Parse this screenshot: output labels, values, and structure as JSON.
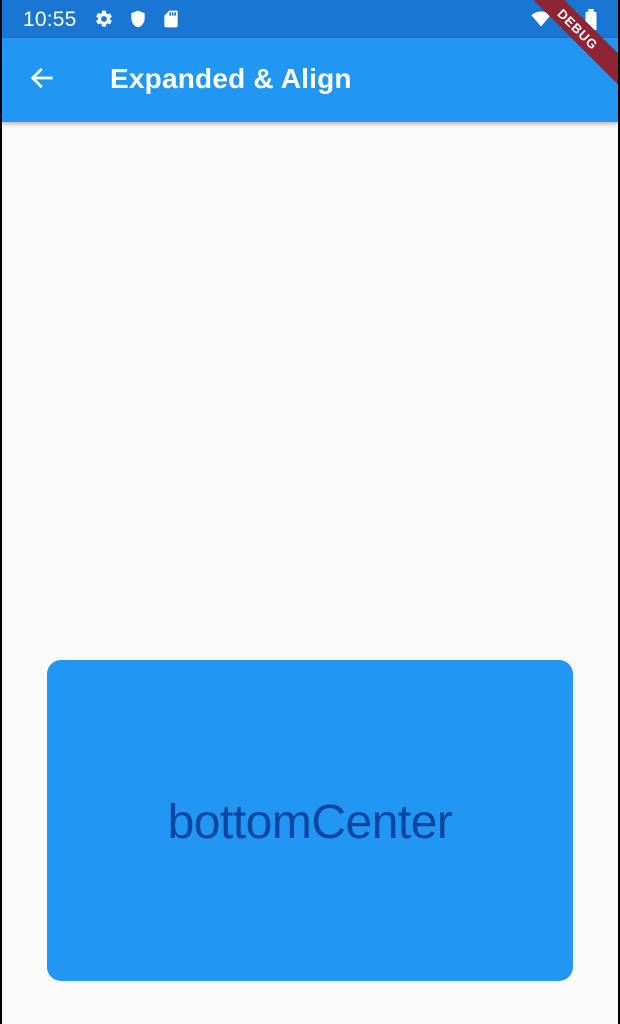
{
  "status_bar": {
    "time": "10:55",
    "icons": [
      "settings-icon",
      "shield-icon",
      "sd-card-icon",
      "wifi-icon",
      "signal-icon",
      "battery-icon"
    ],
    "color": "#1976d2"
  },
  "app_bar": {
    "title": "Expanded & Align",
    "back_icon": "arrow-back-icon",
    "color": "#2196f3"
  },
  "content": {
    "box_label": "bottomCenter",
    "box_color": "#2196f3",
    "label_color": "#0d47a1",
    "background": "#fafafa"
  },
  "debug_banner": {
    "label": "DEBUG",
    "color": "#8e2434"
  }
}
